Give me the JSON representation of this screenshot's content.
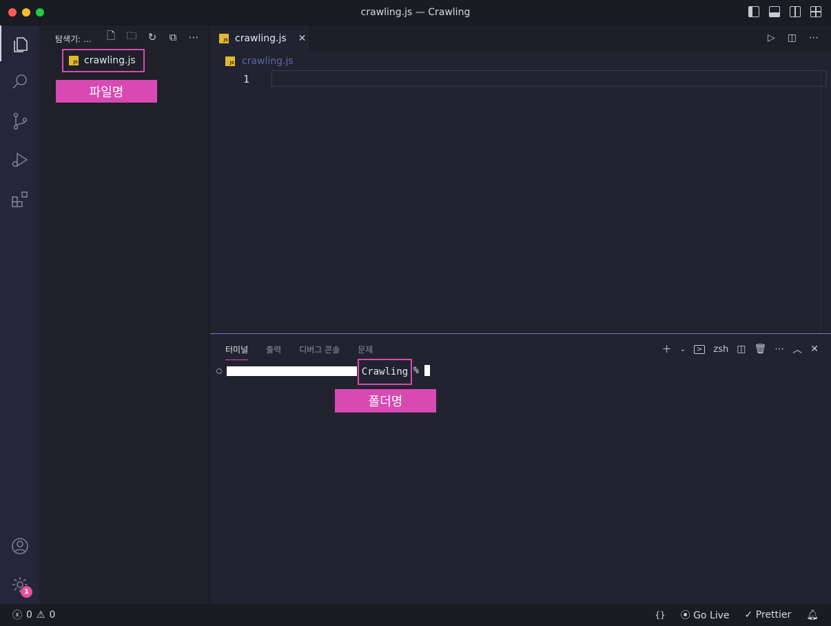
{
  "window": {
    "title": "crawling.js — Crawling"
  },
  "explorer": {
    "header": "탐색기: ...",
    "file": {
      "name": "crawling.js",
      "icon": "js-file-icon"
    },
    "annotation_label": "파일명"
  },
  "editor": {
    "tab": {
      "label": "crawling.js",
      "icon": "js-file-icon"
    },
    "breadcrumb": "crawling.js",
    "line_number": "1"
  },
  "panel": {
    "tabs": [
      {
        "label": "터미널",
        "active": true
      },
      {
        "label": "출력"
      },
      {
        "label": "디버그 콘솔"
      },
      {
        "label": "문제"
      }
    ],
    "shell": "zsh",
    "prompt": {
      "folder": "Crawling",
      "symbol": "%"
    },
    "annotation_label": "폴더명"
  },
  "statusbar": {
    "errors": "0",
    "warnings": "0",
    "braces": "{}",
    "go_live": "Go Live",
    "prettier": "Prettier"
  },
  "activity": {
    "settings_badge": "1"
  },
  "colors": {
    "accent": "#d84ab2",
    "panel_border": "#8e6fc9",
    "js_icon": "#e3b92f"
  }
}
